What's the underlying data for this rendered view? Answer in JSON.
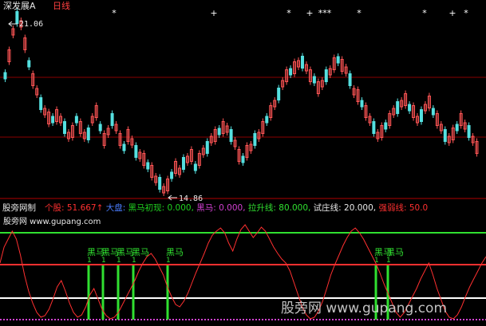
{
  "top": {
    "stock_name": "深发展A",
    "period": "日线",
    "high_label": "21.06",
    "low_label": "14.86"
  },
  "indicator": {
    "name": "股旁网制",
    "site": "股旁网 www.gupang.com",
    "entries": [
      {
        "label": "个股:",
        "value": "51.667",
        "arrow": "↑",
        "color": "#ff3030"
      },
      {
        "label": "大盘:",
        "value": "",
        "color": "#4a7dff"
      },
      {
        "label": "黑马初现:",
        "value": "0.000,",
        "color": "#20d020"
      },
      {
        "label": "黑马:",
        "value": "0.000,",
        "color": "#d040d0"
      },
      {
        "label": "拉升线:",
        "value": "80.000,",
        "color": "#30e030"
      },
      {
        "label": "试庄线:",
        "value": "20.000,",
        "color": "#e8e8e8"
      },
      {
        "label": "强弱线:",
        "value": "50.0",
        "color": "#ff3030"
      }
    ],
    "signal_label": "黑马",
    "signal_sub": "1",
    "signals": [
      {
        "name": "sig-1",
        "label": "黑马",
        "sub": "1"
      },
      {
        "name": "sig-2",
        "label": "黑马",
        "sub": "1"
      },
      {
        "name": "sig-3",
        "label": "黑马",
        "sub": "1"
      },
      {
        "name": "sig-4",
        "label": "黑马",
        "sub": "1"
      },
      {
        "name": "sig-5",
        "label": "黑马",
        "sub": "1"
      },
      {
        "name": "sig-6",
        "label": "黑马",
        "sub": "1"
      },
      {
        "name": "sig-7",
        "label": "黑马",
        "sub": "1"
      }
    ]
  },
  "watermark": "股旁网 www.gupang.com",
  "colors": {
    "up": "#ff5555",
    "down": "#55e0e0",
    "grid": "#8a0000",
    "line": "#ff3030",
    "green": "#30e030",
    "white": "#ffffff",
    "magenta": "#d040d0"
  },
  "markers": [
    "*",
    "+",
    "*",
    "+",
    "***",
    "*",
    "*",
    "+",
    "*"
  ]
}
